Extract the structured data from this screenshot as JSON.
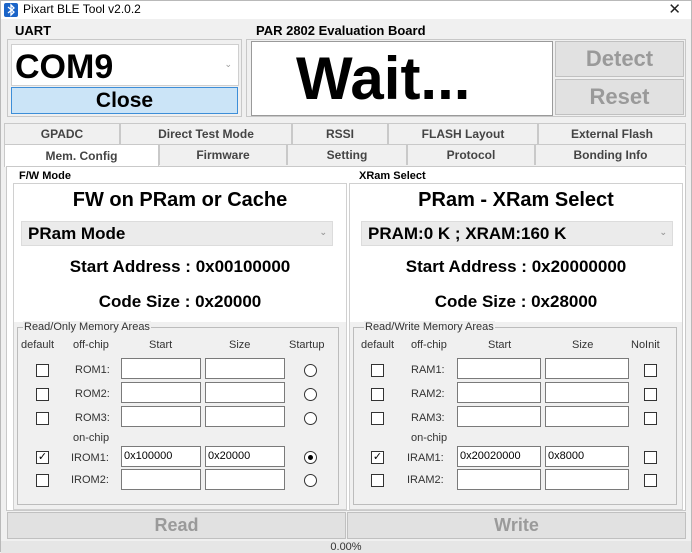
{
  "window": {
    "title": "Pixart BLE Tool v2.0.2"
  },
  "uart": {
    "label": "UART",
    "port": "COM9",
    "close_label": "Close"
  },
  "board": {
    "label": "PAR 2802 Evaluation Board",
    "status": "Wait...",
    "detect_label": "Detect",
    "reset_label": "Reset"
  },
  "tabs": {
    "row1": [
      "GPADC",
      "Direct Test Mode",
      "RSSI",
      "FLASH Layout",
      "External Flash"
    ],
    "row2": [
      "Mem. Config",
      "Firmware",
      "Setting",
      "Protocol",
      "Bonding Info"
    ]
  },
  "fw_mode": {
    "section": "F/W Mode",
    "heading": "FW on PRam or Cache",
    "combo": "PRam Mode",
    "start_address": "Start Address : 0x00100000",
    "code_size": "Code Size : 0x20000",
    "group": "Read/Only Memory Areas",
    "headers": {
      "default": "default",
      "offchip": "off-chip",
      "start": "Start",
      "size": "Size",
      "last": "Startup"
    },
    "onchip": "on-chip",
    "rows": [
      {
        "label": "ROM1:",
        "checked": false,
        "start": "",
        "size": "",
        "radio": false
      },
      {
        "label": "ROM2:",
        "checked": false,
        "start": "",
        "size": "",
        "radio": false
      },
      {
        "label": "ROM3:",
        "checked": false,
        "start": "",
        "size": "",
        "radio": false
      },
      {
        "label": "IROM1:",
        "checked": true,
        "start": "0x100000",
        "size": "0x20000",
        "radio": true
      },
      {
        "label": "IROM2:",
        "checked": false,
        "start": "",
        "size": "",
        "radio": false
      }
    ]
  },
  "xram": {
    "section": "XRam Select",
    "heading": "PRam - XRam Select",
    "combo": "PRAM:0 K ; XRAM:160 K",
    "start_address": "Start Address : 0x20000000",
    "code_size": "Code Size : 0x28000",
    "group": "Read/Write Memory Areas",
    "headers": {
      "default": "default",
      "offchip": "off-chip",
      "start": "Start",
      "size": "Size",
      "last": "NoInit"
    },
    "onchip": "on-chip",
    "rows": [
      {
        "label": "RAM1:",
        "checked": false,
        "start": "",
        "size": "",
        "noinit": false
      },
      {
        "label": "RAM2:",
        "checked": false,
        "start": "",
        "size": "",
        "noinit": false
      },
      {
        "label": "RAM3:",
        "checked": false,
        "start": "",
        "size": "",
        "noinit": false
      },
      {
        "label": "IRAM1:",
        "checked": true,
        "start": "0x20020000",
        "size": "0x8000",
        "noinit": false
      },
      {
        "label": "IRAM2:",
        "checked": false,
        "start": "",
        "size": "",
        "noinit": false
      }
    ]
  },
  "actions": {
    "read_label": "Read",
    "write_label": "Write"
  },
  "status": {
    "progress_text": "0.00%",
    "progress": 0
  },
  "icons": {
    "app": "bluetooth-app-icon",
    "close": "close-icon",
    "combo": "chevron-down-icon"
  }
}
